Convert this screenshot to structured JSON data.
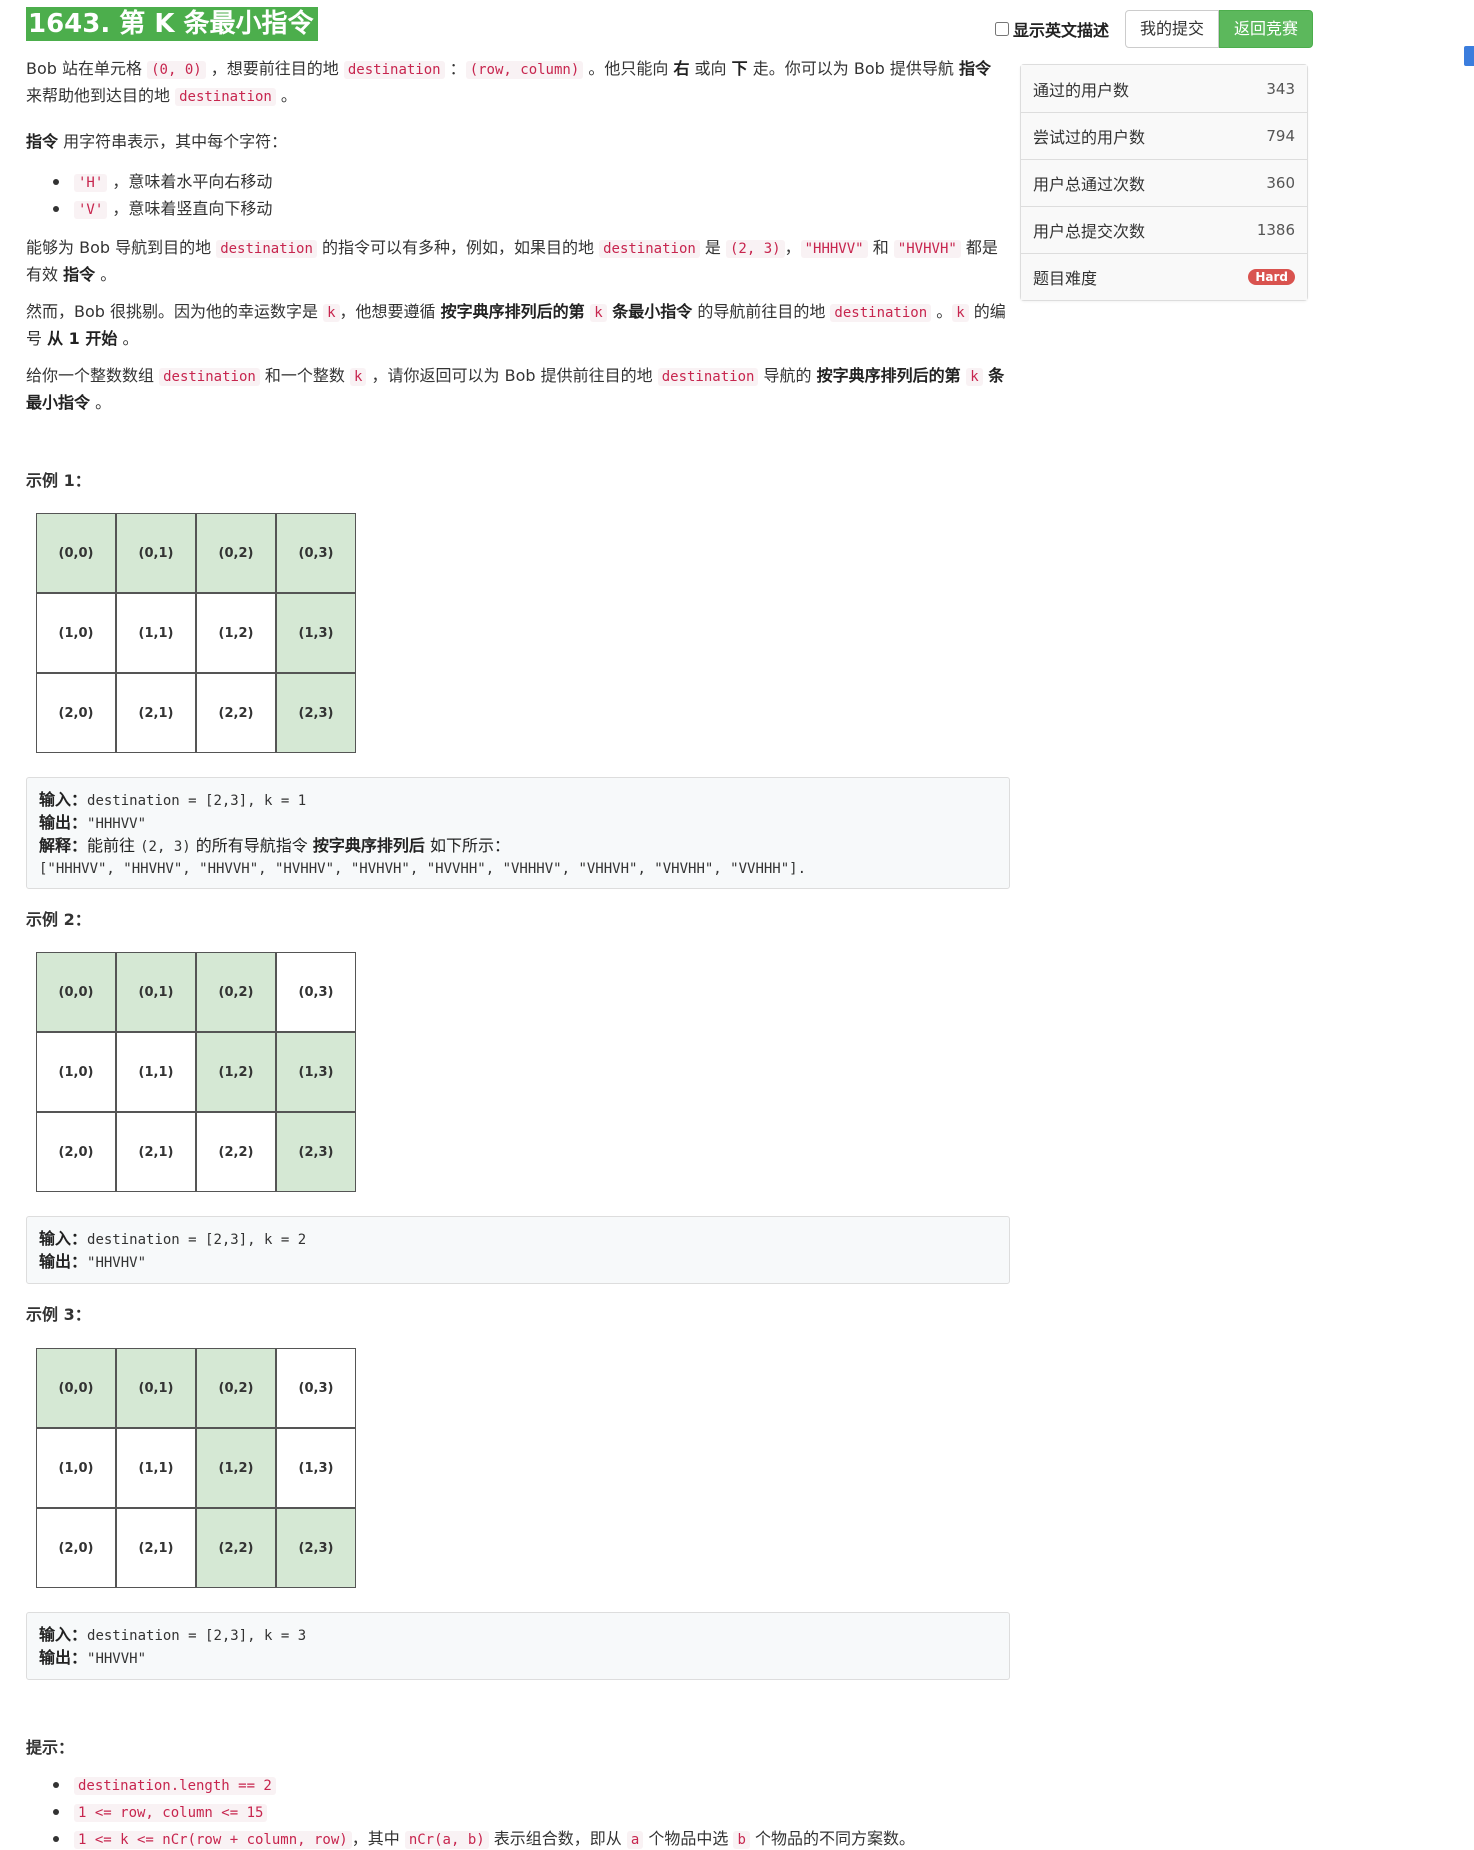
{
  "title": "1643. 第 K 条最小指令",
  "top": {
    "show_english": "显示英文描述",
    "my_submissions": "我的提交",
    "back_to_contest": "返回竞赛"
  },
  "stats": [
    {
      "label": "通过的用户数",
      "value": "343"
    },
    {
      "label": "尝试过的用户数",
      "value": "794"
    },
    {
      "label": "用户总通过次数",
      "value": "360"
    },
    {
      "label": "用户总提交次数",
      "value": "1386"
    },
    {
      "label": "题目难度",
      "value": "Hard"
    }
  ],
  "intro": {
    "p1_a": "Bob 站在单元格 ",
    "p1_code1": "(0, 0)",
    "p1_b": " ，想要前往目的地 ",
    "p1_code2": "destination",
    "p1_c": " ：",
    "p1_code3": "(row, column)",
    "p1_d": " 。他只能向 ",
    "p1_right": "右",
    "p1_e": " 或向 ",
    "p1_down": "下",
    "p1_f": " 走。你可以为 Bob 提供导航 ",
    "p1_cmd": "指令",
    "p1_g": " 来帮助他到达目的地 ",
    "p1_code4": "destination",
    "p1_h": " 。",
    "p2_cmd": "指令",
    "p2_rest": " 用字符串表示，其中每个字符：",
    "bullet1_code": "'H'",
    "bullet1_text": " ，意味着水平向右移动",
    "bullet2_code": "'V'",
    "bullet2_text": " ，意味着竖直向下移动",
    "p3_a": "能够为 Bob 导航到目的地 ",
    "p3_code1": "destination",
    "p3_b": " 的指令可以有多种，例如，如果目的地 ",
    "p3_code2": "destination",
    "p3_c": " 是 ",
    "p3_code3": "(2, 3)",
    "p3_d": "，",
    "p3_code4": "\"HHHVV\"",
    "p3_e": " 和 ",
    "p3_code5": "\"HVHVH\"",
    "p3_f": " 都是有效 ",
    "p3_cmd": "指令",
    "p3_g": " 。",
    "p4_a": "然而，Bob 很挑剔。因为他的幸运数字是 ",
    "p4_code1": "k",
    "p4_b": "，他想要遵循 ",
    "p4_bold1": "按字典序排列后的第 ",
    "p4_code2": "k",
    "p4_bold2": " 条最小指令",
    "p4_c": " 的导航前往目的地 ",
    "p4_code3": "destination",
    "p4_d": " 。",
    "p4_code4": "k",
    "p4_e": "  的编号 ",
    "p4_bold3": "从 1 开始",
    "p4_f": " 。",
    "p5_a": "给你一个整数数组 ",
    "p5_code1": "destination",
    "p5_b": " 和一个整数 ",
    "p5_code2": "k",
    "p5_c": " ，请你返回可以为 Bob 提供前往目的地 ",
    "p5_code3": "destination",
    "p5_d": " 导航的 ",
    "p5_bold1": "按字典序排列后的第 ",
    "p5_code4": "k",
    "p5_bold2": " 条最小指令",
    "p5_e": " 。"
  },
  "examples": [
    {
      "title": "示例 1：",
      "cells": [
        [
          "(0,0)",
          "(0,1)",
          "(0,2)",
          "(0,3)"
        ],
        [
          "(1,0)",
          "(1,1)",
          "(1,2)",
          "(1,3)"
        ],
        [
          "(2,0)",
          "(2,1)",
          "(2,2)",
          "(2,3)"
        ]
      ],
      "highlight": [
        [
          1,
          1,
          1,
          1
        ],
        [
          0,
          0,
          0,
          1
        ],
        [
          0,
          0,
          0,
          1
        ]
      ],
      "input_label": "输入：",
      "input": "destination = [2,3], k = 1",
      "output_label": "输出：",
      "output": "\"HHHVV\"",
      "explain_label": "解释：",
      "explain_a": "能前往 ",
      "explain_code": "(2, 3)",
      "explain_b": " 的所有导航指令 ",
      "explain_bold": "按字典序排列后",
      "explain_c": " 如下所示：",
      "explain_list": "[\"HHHVV\", \"HHVHV\", \"HHVVH\", \"HVHHV\", \"HVHVH\", \"HVVHH\", \"VHHHV\", \"VHHVH\", \"VHVHH\", \"VVHHH\"]."
    },
    {
      "title": "示例 2：",
      "cells": [
        [
          "(0,0)",
          "(0,1)",
          "(0,2)",
          "(0,3)"
        ],
        [
          "(1,0)",
          "(1,1)",
          "(1,2)",
          "(1,3)"
        ],
        [
          "(2,0)",
          "(2,1)",
          "(2,2)",
          "(2,3)"
        ]
      ],
      "highlight": [
        [
          1,
          1,
          1,
          0
        ],
        [
          0,
          0,
          1,
          1
        ],
        [
          0,
          0,
          0,
          1
        ]
      ],
      "input_label": "输入：",
      "input": "destination = [2,3], k = 2",
      "output_label": "输出：",
      "output": "\"HHVHV\""
    },
    {
      "title": "示例 3：",
      "cells": [
        [
          "(0,0)",
          "(0,1)",
          "(0,2)",
          "(0,3)"
        ],
        [
          "(1,0)",
          "(1,1)",
          "(1,2)",
          "(1,3)"
        ],
        [
          "(2,0)",
          "(2,1)",
          "(2,2)",
          "(2,3)"
        ]
      ],
      "highlight": [
        [
          1,
          1,
          1,
          0
        ],
        [
          0,
          0,
          1,
          0
        ],
        [
          0,
          0,
          1,
          1
        ]
      ],
      "input_label": "输入：",
      "input": "destination = [2,3], k = 3",
      "output_label": "输出：",
      "output": "\"HHVVH\""
    }
  ],
  "hints": {
    "title": "提示：",
    "h1_code": "destination.length == 2",
    "h2_code": "1 <= row, column <= 15",
    "h3_code1": "1 <= k <= nCr(row + column, row)",
    "h3_a": "，其中 ",
    "h3_code2": "nCr(a, b)",
    "h3_b": " 表示组合数，即从 ",
    "h3_code3": "a",
    "h3_c": " 个物品中选 ",
    "h3_code4": "b",
    "h3_d": " 个物品的不同方案数。"
  }
}
